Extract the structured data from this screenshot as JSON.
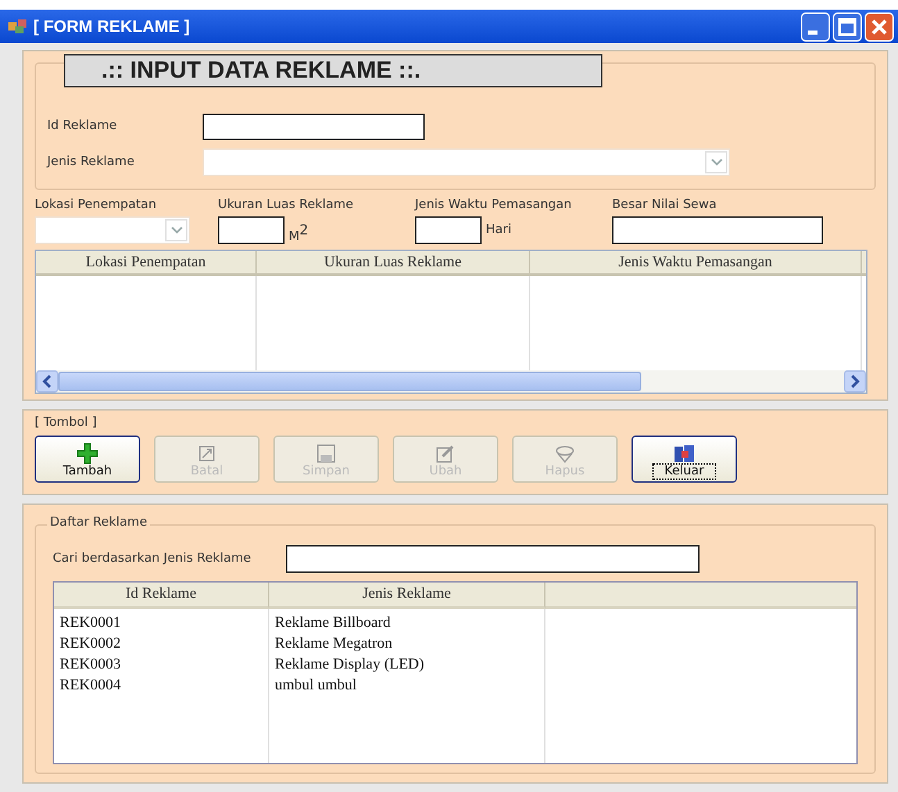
{
  "window": {
    "title": "[ FORM REKLAME ]"
  },
  "input_section": {
    "title": ".:: INPUT DATA REKLAME ::.",
    "fields": [
      {
        "label": "Id Reklame",
        "kind": "text"
      },
      {
        "label": "Jenis Reklame",
        "kind": "combo"
      }
    ]
  },
  "detail_fields": [
    {
      "label": "Lokasi Penempatan",
      "kind": "combo"
    },
    {
      "label": "Ukuran Luas Reklame",
      "kind": "short",
      "suffix": "M$^{2}$"
    },
    {
      "label": "Jenis Waktu Pemasangan",
      "kind": "short",
      "suffix": "Hari"
    },
    {
      "label": "Besar Nilai Sewa",
      "kind": "wide"
    }
  ],
  "grid": {
    "columns": [
      "Lokasi Penempatan",
      "Ukuran Luas Reklame",
      "Jenis Waktu Pemasangan"
    ]
  },
  "button_group": {
    "title": "[ Tombol ]",
    "buttons": [
      {
        "label": "Tambah",
        "kind": "add",
        "disabled": false,
        "focused": false
      },
      {
        "label": "Batal",
        "kind": "cancel",
        "disabled": true,
        "focused": false
      },
      {
        "label": "Simpan",
        "kind": "save",
        "disabled": true,
        "focused": false
      },
      {
        "label": "Ubah",
        "kind": "edit",
        "disabled": true,
        "focused": false
      },
      {
        "label": "Hapus",
        "kind": "delete",
        "disabled": true,
        "focused": false
      },
      {
        "label": "Keluar",
        "kind": "exit",
        "disabled": false,
        "focused": true
      }
    ]
  },
  "list_section": {
    "title": "Daftar Reklame",
    "search_label": "Cari berdasarkan Jenis Reklame",
    "columns": [
      "Id Reklame",
      "Jenis Reklame"
    ],
    "rows": [
      [
        "REK0001",
        "Reklame Billboard"
      ],
      [
        "REK0002",
        "Reklame Megatron"
      ],
      [
        "REK0003",
        "Reklame Display (LED)"
      ],
      [
        "REK0004",
        "umbul umbul"
      ]
    ]
  }
}
